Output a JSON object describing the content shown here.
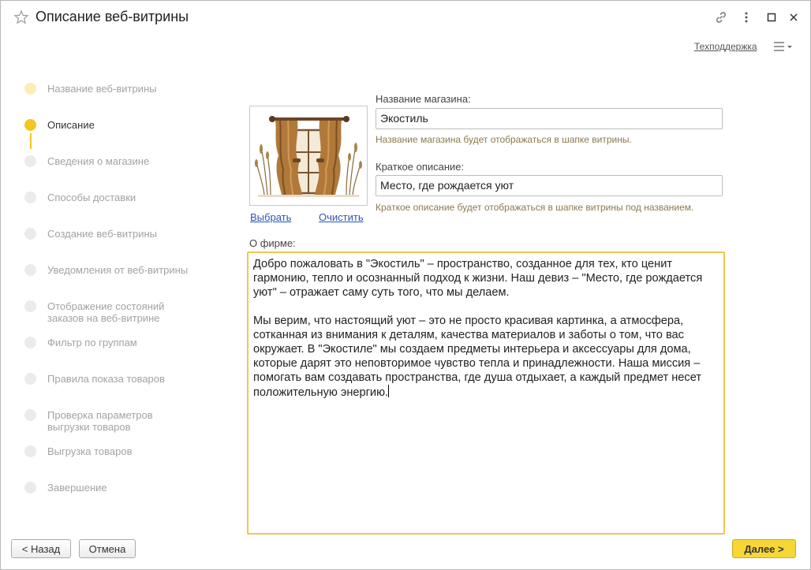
{
  "window": {
    "title": "Описание веб-витрины"
  },
  "header": {
    "support_link": "Техподдержка"
  },
  "steps": [
    {
      "label": "Название веб-витрины",
      "state": "done"
    },
    {
      "label": "Описание",
      "state": "current"
    },
    {
      "label": "Сведения о магазине",
      "state": "pending"
    },
    {
      "label": "Способы доставки",
      "state": "pending"
    },
    {
      "label": "Создание веб-витрины",
      "state": "pending"
    },
    {
      "label": "Уведомления от веб-витрины",
      "state": "pending"
    },
    {
      "label": "Отображение состояний заказов на веб-витрине",
      "state": "pending"
    },
    {
      "label": "Фильтр по группам",
      "state": "pending"
    },
    {
      "label": "Правила показа товаров",
      "state": "pending"
    },
    {
      "label": "Проверка параметров выгрузки товаров",
      "state": "pending"
    },
    {
      "label": "Выгрузка товаров",
      "state": "pending"
    },
    {
      "label": "Завершение",
      "state": "pending"
    }
  ],
  "image": {
    "choose_label": "Выбрать",
    "clear_label": "Очистить"
  },
  "form": {
    "store_name_label": "Название магазина:",
    "store_name_value": "Экостиль",
    "store_name_hint": "Название магазина будет отображаться в шапке витрины.",
    "short_desc_label": "Краткое описание:",
    "short_desc_value": "Место, где рождается уют",
    "short_desc_hint": "Краткое описание будет отображаться в шапке витрины под названием.",
    "about_label": "О фирме:",
    "about_value": "Добро пожаловать в \"Экостиль\" – пространство, созданное для тех, кто ценит гармонию, тепло и осознанный подход к жизни. Наш девиз – \"Место, где рождается уют\" – отражает саму суть того, что мы делаем.\n\nМы верим, что настоящий уют – это не просто красивая картинка, а атмосфера, сотканная из внимания к деталям, качества материалов и заботы о том, что вас окружает. В \"Экостиле\" мы создаем предметы интерьера и аксессуары для дома, которые дарят это неповторимое чувство тепла и принадлежности. Наша миссия – помогать вам создавать пространства, где душа отдыхает, а каждый предмет несет положительную энергию."
  },
  "buttons": {
    "back_label": "< Назад",
    "cancel_label": "Отмена",
    "next_label": "Далее >"
  },
  "colors": {
    "accent": "#f5c522",
    "next_button": "#f7d736",
    "hint_text": "#8b7a4e",
    "link": "#2a55b4",
    "focus_border": "#f2c54f"
  }
}
